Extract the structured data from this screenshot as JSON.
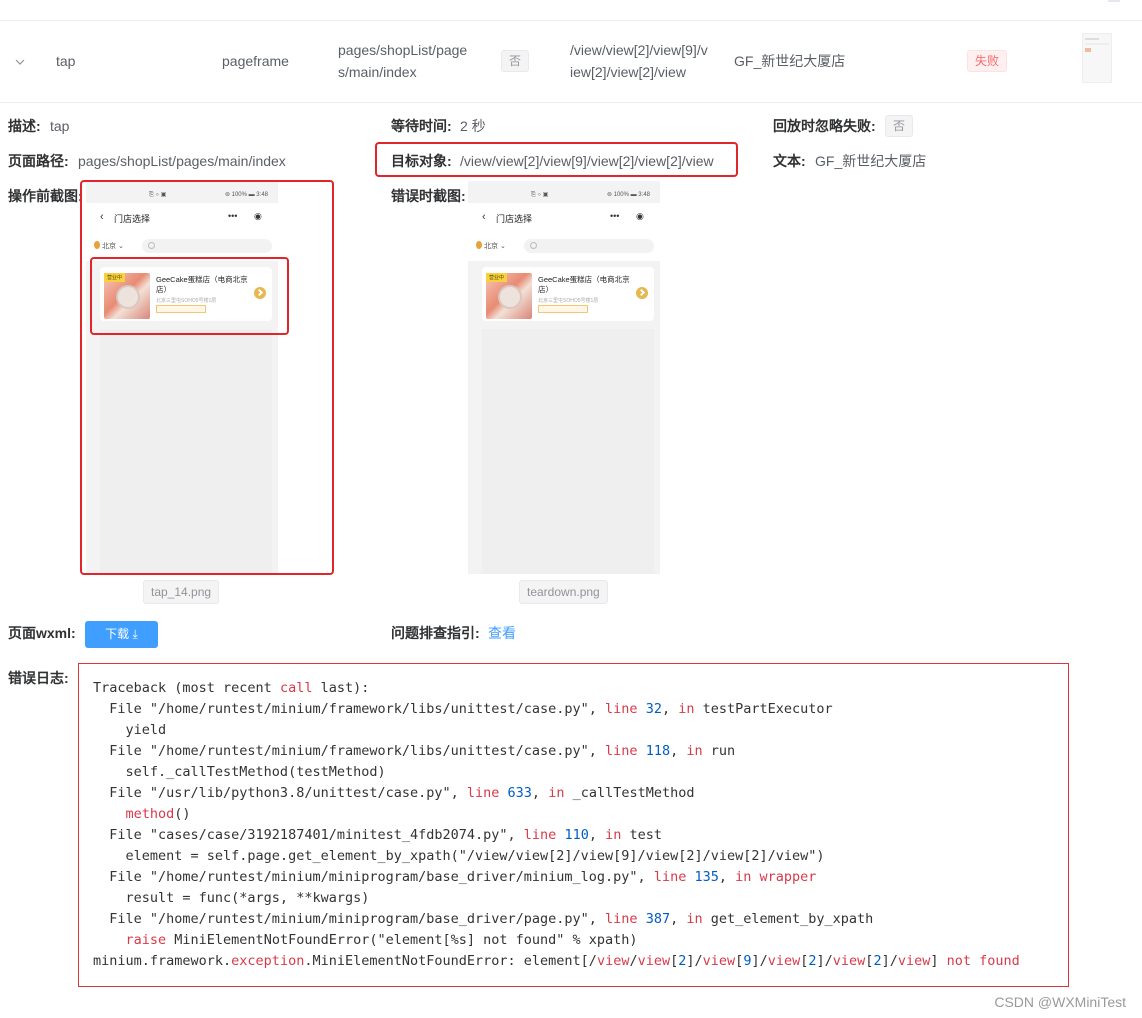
{
  "row": {
    "action": "tap",
    "frame": "pageframe",
    "path_line1": "pages/shopList/page",
    "path_line2": "s/main/index",
    "flag": "否",
    "target_line1": "/view/view[2]/view[9]/v",
    "target_line2": "iew[2]/view[2]/view",
    "text": "GF_新世纪大厦店",
    "status": "失败"
  },
  "details": {
    "desc_label": "描述:",
    "desc_value": "tap",
    "wait_label": "等待时间:",
    "wait_value": "2 秒",
    "ignore_label": "回放时忽略失败:",
    "ignore_value": "否",
    "path_label": "页面路径:",
    "path_value": "pages/shopList/pages/main/index",
    "target_label": "目标对象:",
    "target_value": "/view/view[2]/view[9]/view[2]/view[2]/view",
    "text_label": "文本:",
    "text_value": "GF_新世纪大厦店",
    "before_label": "操作前截图:",
    "error_label": "错误时截图:",
    "before_file": "tap_14.png",
    "error_file": "teardown.png",
    "wxml_label": "页面wxml:",
    "download_label": "下载 ⤓",
    "guide_label": "问题排查指引:",
    "guide_link": "查看",
    "log_label": "错误日志:"
  },
  "phone": {
    "status_left": "⎘ ⌔ ▣",
    "status_right": "⊚ 100% ▬ 3:48",
    "back": "‹",
    "title": "门店选择",
    "more": "•••",
    "record": "◉",
    "city": "北京 ⌄",
    "badge": "营业中",
    "store_name": "GeeCake蛋糕店（电商北京店）",
    "store_addr": "北京三里屯SOHO5号楼1层"
  },
  "log_lines": [
    [
      {
        "t": "Traceback (most recent "
      },
      {
        "t": "call",
        "c": "kw"
      },
      {
        "t": " last):"
      }
    ],
    [
      {
        "t": "  File \"/home/runtest/minium/framework/libs/unittest/case.py\", "
      },
      {
        "t": "line",
        "c": "kw"
      },
      {
        "t": " "
      },
      {
        "t": "32",
        "c": "num"
      },
      {
        "t": ", "
      },
      {
        "t": "in",
        "c": "kw"
      },
      {
        "t": " testPartExecutor"
      }
    ],
    [
      {
        "t": "    yield"
      }
    ],
    [
      {
        "t": "  File \"/home/runtest/minium/framework/libs/unittest/case.py\", "
      },
      {
        "t": "line",
        "c": "kw"
      },
      {
        "t": " "
      },
      {
        "t": "118",
        "c": "num"
      },
      {
        "t": ", "
      },
      {
        "t": "in",
        "c": "kw"
      },
      {
        "t": " run"
      }
    ],
    [
      {
        "t": "    self._callTestMethod(testMethod)"
      }
    ],
    [
      {
        "t": "  File \"/usr/lib/python3.8/unittest/case.py\", "
      },
      {
        "t": "line",
        "c": "kw"
      },
      {
        "t": " "
      },
      {
        "t": "633",
        "c": "num"
      },
      {
        "t": ", "
      },
      {
        "t": "in",
        "c": "kw"
      },
      {
        "t": " _callTestMethod"
      }
    ],
    [
      {
        "t": "    "
      },
      {
        "t": "method",
        "c": "kw"
      },
      {
        "t": "()"
      }
    ],
    [
      {
        "t": "  File \"cases/case/3192187401/minitest_4fdb2074.py\", "
      },
      {
        "t": "line",
        "c": "kw"
      },
      {
        "t": " "
      },
      {
        "t": "110",
        "c": "num"
      },
      {
        "t": ", "
      },
      {
        "t": "in",
        "c": "kw"
      },
      {
        "t": " test"
      }
    ],
    [
      {
        "t": "    element = self.page.get_element_by_xpath(\"/view/view[2]/view[9]/view[2]/view[2]/view\")"
      }
    ],
    [
      {
        "t": "  File \"/home/runtest/minium/miniprogram/base_driver/minium_log.py\", "
      },
      {
        "t": "line",
        "c": "kw"
      },
      {
        "t": " "
      },
      {
        "t": "135",
        "c": "num"
      },
      {
        "t": ", "
      },
      {
        "t": "in",
        "c": "kw"
      },
      {
        "t": " "
      },
      {
        "t": "wrapper",
        "c": "kw"
      }
    ],
    [
      {
        "t": "    result = func(*args, **kwargs)"
      }
    ],
    [
      {
        "t": "  File \"/home/runtest/minium/miniprogram/base_driver/page.py\", "
      },
      {
        "t": "line",
        "c": "kw"
      },
      {
        "t": " "
      },
      {
        "t": "387",
        "c": "num"
      },
      {
        "t": ", "
      },
      {
        "t": "in",
        "c": "kw"
      },
      {
        "t": " get_element_by_xpath"
      }
    ],
    [
      {
        "t": "    "
      },
      {
        "t": "raise",
        "c": "kw"
      },
      {
        "t": " MiniElementNotFoundError(\"element[%s] not found\" % xpath)"
      }
    ],
    [
      {
        "t": "minium.framework."
      },
      {
        "t": "exception",
        "c": "kw"
      },
      {
        "t": ".MiniElementNotFoundError: element[/"
      },
      {
        "t": "view",
        "c": "kw"
      },
      {
        "t": "/"
      },
      {
        "t": "view",
        "c": "kw"
      },
      {
        "t": "["
      },
      {
        "t": "2",
        "c": "num"
      },
      {
        "t": "]/"
      },
      {
        "t": "view",
        "c": "kw"
      },
      {
        "t": "["
      },
      {
        "t": "9",
        "c": "num"
      },
      {
        "t": "]/"
      },
      {
        "t": "view",
        "c": "kw"
      },
      {
        "t": "["
      },
      {
        "t": "2",
        "c": "num"
      },
      {
        "t": "]/"
      },
      {
        "t": "view",
        "c": "kw"
      },
      {
        "t": "["
      },
      {
        "t": "2",
        "c": "num"
      },
      {
        "t": "]/"
      },
      {
        "t": "view",
        "c": "kw"
      },
      {
        "t": "] "
      },
      {
        "t": "not",
        "c": "kw"
      },
      {
        "t": " "
      },
      {
        "t": "found",
        "c": "kw"
      }
    ]
  ],
  "watermark": "CSDN @WXMiniTest",
  "colors": {
    "primary": "#409eff",
    "danger": "#f56c6c",
    "highlight": "#e0262b"
  }
}
